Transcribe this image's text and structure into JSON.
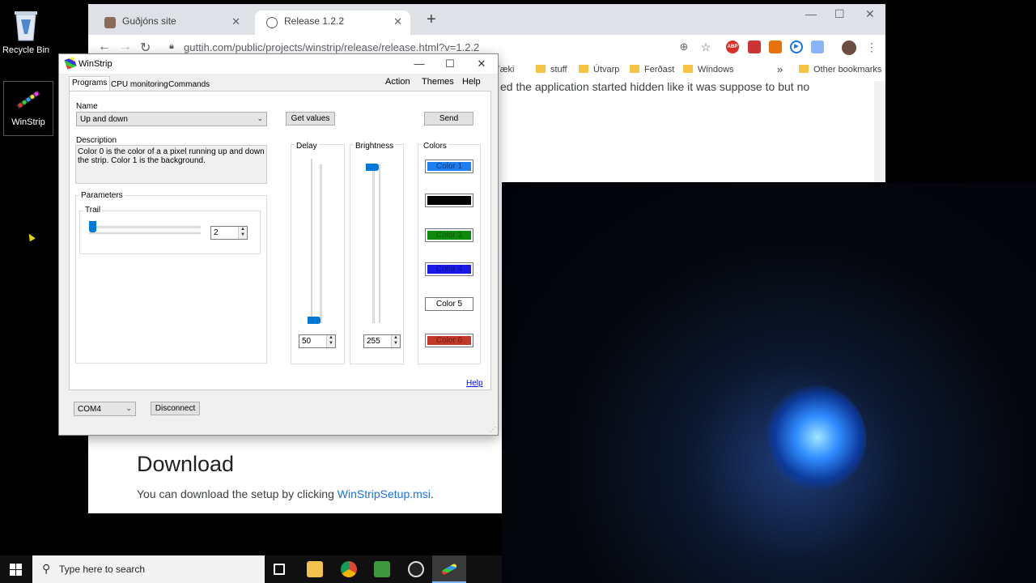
{
  "desktop": {
    "icons": [
      {
        "label": "Recycle Bin",
        "icon": "recycle-bin-icon"
      },
      {
        "label": "WinStrip",
        "icon": "winstrip-app-icon"
      }
    ]
  },
  "browser": {
    "tabs": [
      {
        "label": "Guðjóns site",
        "icon": "site-favicon"
      },
      {
        "label": "Release 1.2.2",
        "icon": "globe-icon"
      }
    ],
    "new_tab_symbol": "+",
    "window_controls": {
      "minimize": "—",
      "maximize": "☐",
      "close": "✕"
    },
    "url": "guttih.com/public/projects/winstrip/release/release.html?v=1.2.2",
    "toolbar_icons": [
      "zoom-icon",
      "star-icon",
      "abp-icon",
      "extension-icon",
      "megaphone-icon",
      "play-icon",
      "extension2-icon",
      "profile-avatar",
      "more-icon"
    ],
    "abp_label": "ABP",
    "bookmarks": [
      "Tæki",
      "stuff",
      "Útvarp",
      "Ferðast",
      "Windows"
    ],
    "bookmarks_overflow": "»",
    "other_bookmarks": "Other bookmarks",
    "page": {
      "partial_text": "ed the application started hidden like it was suppose to but no",
      "heading": "Download",
      "paragraph_prefix": "You can download the setup by clicking ",
      "link_text": "WinStripSetup.msi",
      "paragraph_suffix": "."
    }
  },
  "winstrip": {
    "title": "WinStrip",
    "window_controls": {
      "minimize": "—",
      "maximize": "☐",
      "close": "✕"
    },
    "tabs": [
      "Programs",
      "CPU monitoring",
      "Commands"
    ],
    "menu": [
      "Action",
      "Themes",
      "Help"
    ],
    "name_label": "Name",
    "name_value": "Up and down",
    "get_values_label": "Get values",
    "send_label": "Send",
    "description_label": "Description",
    "description_text": "Color 0 is the color of a a pixel running up and down the strip. Color 1 is the background.",
    "parameters_label": "Parameters",
    "trail_label": "Trail",
    "trail_value": "2",
    "trail_level": 0.0,
    "delay_label": "Delay",
    "delay_value": "50",
    "delay_level": 0.0,
    "brightness_label": "Brightness",
    "brightness_value": "255",
    "brightness_level": 1.0,
    "colors_label": "Colors",
    "colors": [
      {
        "label": "Color 1",
        "bg": "#1e7ff0",
        "fg": "#0a3a8a"
      },
      {
        "label": "Color 2",
        "bg": "#000000",
        "fg": "#000000"
      },
      {
        "label": "Color 3",
        "bg": "#0c8a0c",
        "fg": "#0a5a0a"
      },
      {
        "label": "Color 4",
        "bg": "#1a1ae8",
        "fg": "#0a0a9a"
      },
      {
        "label": "Color 5",
        "bg": "#ffffff",
        "fg": "#000000"
      },
      {
        "label": "Color 6",
        "bg": "#c0392b",
        "fg": "#7a1a12"
      }
    ],
    "help_link": "Help",
    "port_value": "COM4",
    "disconnect_label": "Disconnect",
    "accent": "#0078d7"
  },
  "taskbar": {
    "search_placeholder": "Type here to search",
    "apps": [
      "task-view-icon",
      "file-explorer-icon",
      "chrome-icon",
      "chart-app-icon",
      "obs-icon",
      "winstrip-taskbar-icon"
    ]
  }
}
